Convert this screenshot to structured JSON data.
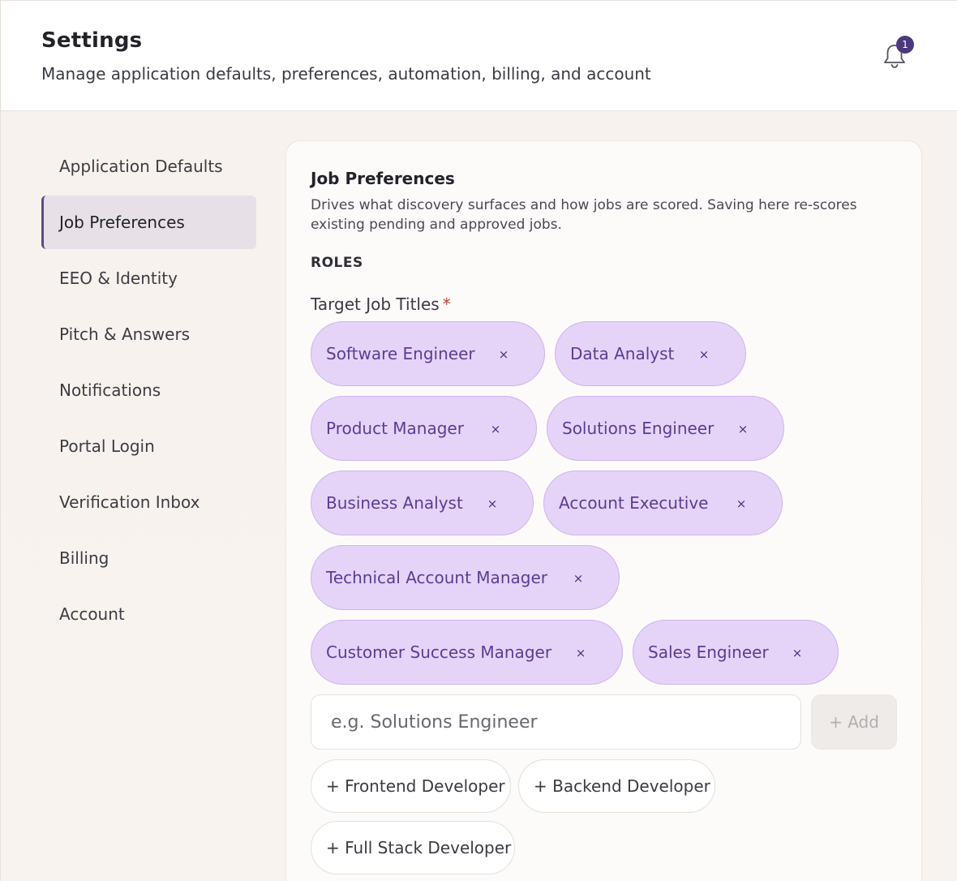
{
  "header": {
    "title": "Settings",
    "subtitle": "Manage application defaults, preferences, automation, billing, and account",
    "notification_count": "1"
  },
  "sidebar": {
    "items": [
      {
        "label": "Application Defaults"
      },
      {
        "label": "Job Preferences",
        "active": true
      },
      {
        "label": "EEO & Identity"
      },
      {
        "label": "Pitch & Answers"
      },
      {
        "label": "Notifications"
      },
      {
        "label": "Portal Login"
      },
      {
        "label": "Verification Inbox"
      },
      {
        "label": "Billing"
      },
      {
        "label": "Account"
      }
    ]
  },
  "panel": {
    "title": "Job Preferences",
    "description": "Drives what discovery surfaces and how jobs are scored. Saving here re-scores existing pending and approved jobs.",
    "section_label": "ROLES",
    "field_label": "Target Job Titles",
    "required_mark": "*",
    "chips": [
      {
        "label": "Software Engineer",
        "remove": "×"
      },
      {
        "label": "Data Analyst",
        "remove": "×"
      },
      {
        "label": "Product Manager",
        "remove": "×"
      },
      {
        "label": "Solutions Engineer",
        "remove": "×"
      },
      {
        "label": "Business Analyst",
        "remove": "×"
      },
      {
        "label": "Account Executive",
        "remove": "×"
      },
      {
        "label": "Technical Account Manager",
        "remove": "×"
      },
      {
        "label": "Customer Success Manager",
        "remove": "×"
      },
      {
        "label": "Sales Engineer",
        "remove": "×"
      }
    ],
    "input_placeholder": "e.g. Solutions Engineer",
    "add_label": "+ Add",
    "suggestions": [
      {
        "label": "+ Frontend Developer"
      },
      {
        "label": "+ Backend Developer"
      },
      {
        "label": "+ Full Stack Developer"
      }
    ]
  },
  "colors": {
    "accent": "#5b4a8a",
    "chip_bg": "#e5d4f8",
    "chip_text": "#5a3d93",
    "badge": "#4a3a7c",
    "required": "#c2413b"
  }
}
